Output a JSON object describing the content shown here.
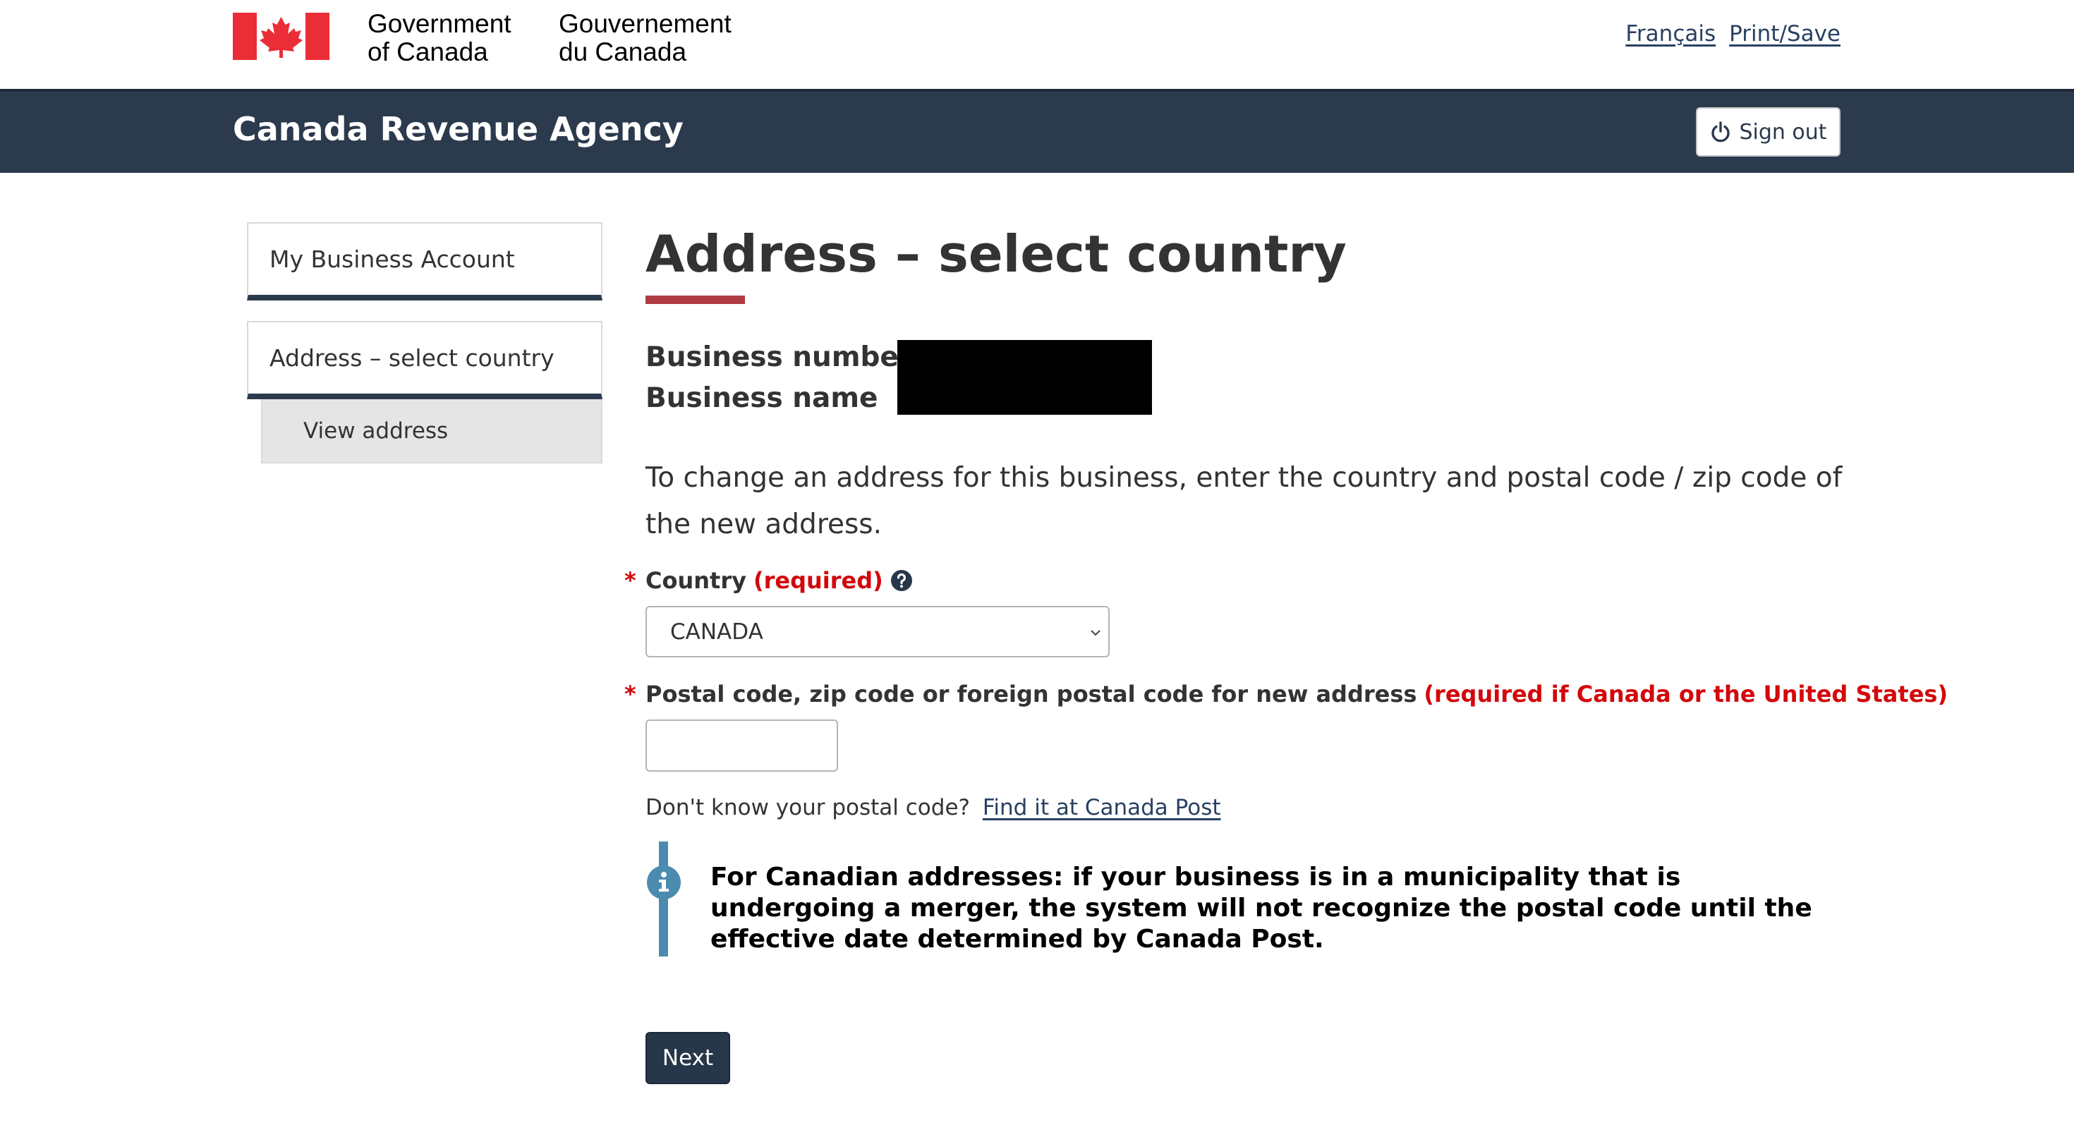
{
  "header": {
    "gov_name_en_line1": "Government",
    "gov_name_en_line2": "of Canada",
    "gov_name_fr_line1": "Gouvernement",
    "gov_name_fr_line2": "du Canada",
    "language_link": "Français",
    "print_link": "Print/Save",
    "flag_icon": "canada-flag-icon",
    "flag_color": "#eb2d37"
  },
  "agency_bar": {
    "title": "Canada Revenue Agency",
    "signout_label": "Sign out",
    "signout_icon": "power-icon",
    "background": "#2b3a4d"
  },
  "sidebar": {
    "items": [
      {
        "label": "My Business Account"
      },
      {
        "label": "Address  – select country"
      }
    ],
    "sub_items": [
      {
        "label": "View address"
      }
    ]
  },
  "main": {
    "title": "Address  – select country",
    "business_number_label": "Business number",
    "business_name_label": "Business name",
    "intro": "To change an address for this business, enter the country and postal code / zip code of the new address.",
    "country_field": {
      "required_marker": "*",
      "label": "Country",
      "required_text": "(required)",
      "help_icon": "question-circle-icon",
      "selected_value": "CANADA"
    },
    "postal_field": {
      "required_marker": "*",
      "label": "Postal code, zip code or foreign postal code for new address",
      "required_text": "(required if Canada or the United States)",
      "value": ""
    },
    "postal_help_text": "Don't know your postal code?",
    "postal_help_link": "Find it at Canada Post",
    "info_icon": "info-circle-icon",
    "info_message": "For Canadian addresses: if your business is in a municipality that is undergoing a merger, the system will not recognize the postal code until the effective date determined by Canada Post.",
    "next_label": "Next"
  },
  "colors": {
    "accent_red": "#af3c43",
    "required_red": "#d3080c",
    "link_blue": "#284162",
    "info_blue": "#4b8bb0",
    "button_dark": "#26374a"
  }
}
